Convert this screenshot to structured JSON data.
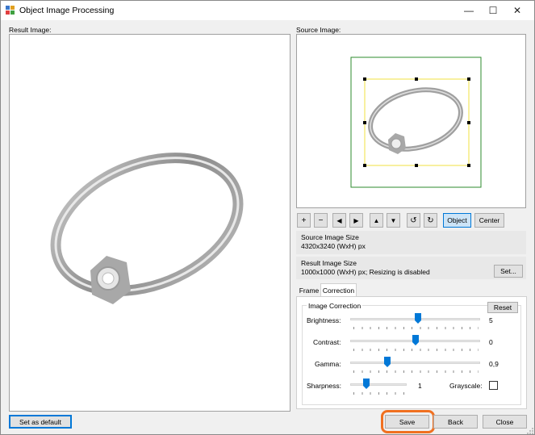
{
  "window": {
    "title": "Object Image Processing",
    "minimize_label": "—",
    "maximize_label": "☐",
    "close_label": "✕"
  },
  "result_image": {
    "label": "Result Image:"
  },
  "source_image": {
    "label": "Source Image:"
  },
  "toolbar": {
    "zoom_in": "+",
    "zoom_out": "−",
    "move_left": "◀",
    "move_right": "▶",
    "move_up": "▲",
    "move_down": "▼",
    "rotate_ccw": "↺",
    "rotate_cw": "↻",
    "object_label": "Object",
    "center_label": "Center"
  },
  "source_size": {
    "title": "Source Image Size",
    "value": "4320x3240 (WxH) px"
  },
  "result_size": {
    "title": "Result Image Size",
    "value": "1000x1000 (WxH) px; Resizing is disabled",
    "set_label": "Set..."
  },
  "tabs": [
    {
      "label": "Frame",
      "active": false
    },
    {
      "label": "Correction",
      "active": true
    }
  ],
  "correction": {
    "group_title": "Image Correction",
    "reset_label": "Reset",
    "brightness": {
      "label": "Brightness:",
      "value": "5",
      "level": 0.52
    },
    "contrast": {
      "label": "Contrast:",
      "value": "0",
      "level": 0.5
    },
    "gamma": {
      "label": "Gamma:",
      "value": "0,9",
      "level": 0.29
    },
    "sharpness": {
      "label": "Sharpness:",
      "value": "1",
      "level": 0.25
    },
    "grayscale": {
      "label": "Grayscale:",
      "checked": false
    }
  },
  "footer": {
    "set_default_label": "Set as default",
    "save_label": "Save",
    "back_label": "Back",
    "close_label": "Close"
  },
  "colors": {
    "accent": "#0078d7",
    "highlight_ring": "#f07020",
    "object_frame": "#2e8b2e",
    "crop_frame": "#f0e040"
  }
}
